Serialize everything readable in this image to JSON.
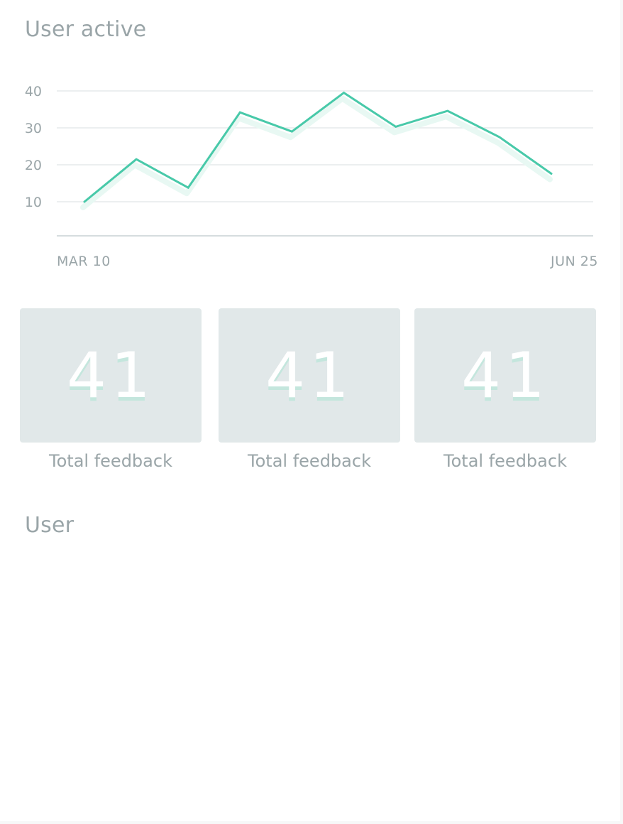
{
  "sections": {
    "user_active_title": "User active",
    "user_title": "User"
  },
  "colors": {
    "line": "#48c9a9",
    "line_shadow": "#e8f8f3",
    "grid": "#e6eaeb",
    "axis": "#c9d1d3",
    "text": "#9aa5a8",
    "card_bg": "#e1e8e9"
  },
  "chart_data": {
    "type": "line",
    "x": [
      0,
      1,
      2,
      3,
      4,
      5,
      6,
      7,
      8,
      9
    ],
    "series": [
      {
        "values": [
          10,
          21.5,
          13.8,
          34.2,
          29,
          39.5,
          30.3,
          34.6,
          27.5,
          17.6
        ]
      }
    ],
    "ylim": [
      0,
      40
    ],
    "yticks": [
      10,
      20,
      30,
      40
    ],
    "xlabels": {
      "start": "MAR 10",
      "end": "JUN 25"
    },
    "grid": true
  },
  "stats": [
    {
      "value": "41",
      "label": "Total feedback"
    },
    {
      "value": "41",
      "label": "Total feedback"
    },
    {
      "value": "41",
      "label": "Total feedback"
    }
  ]
}
